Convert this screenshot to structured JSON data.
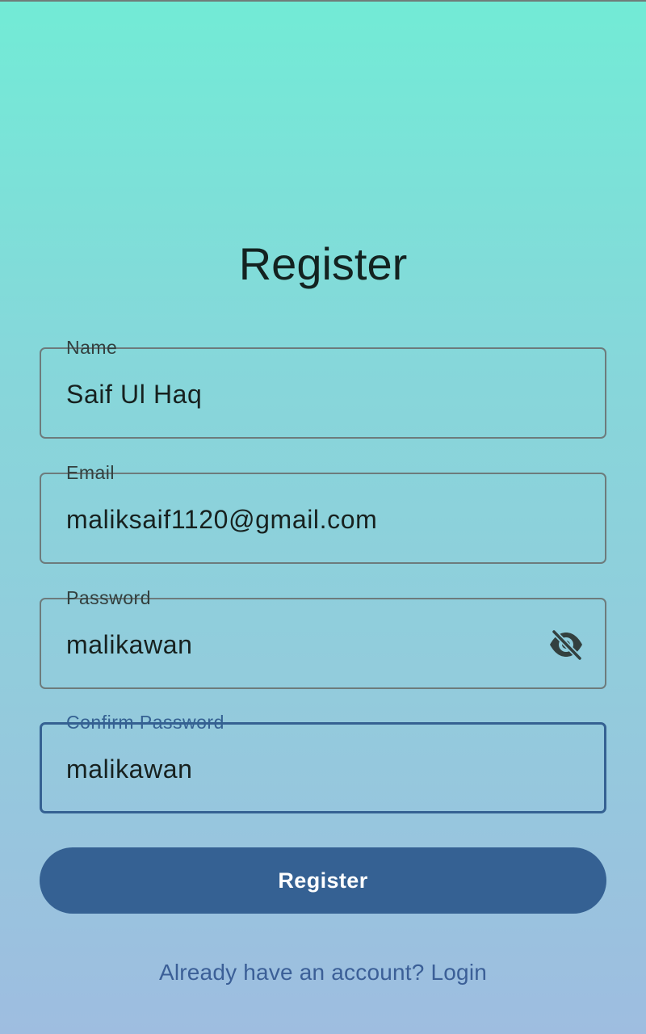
{
  "page": {
    "title": "Register"
  },
  "form": {
    "name": {
      "label": "Name",
      "value": "Saif Ul Haq"
    },
    "email": {
      "label": "Email",
      "value": "maliksaif1120@gmail.com"
    },
    "password": {
      "label": "Password",
      "value": "malikawan",
      "toggle_icon": "eye-off-icon"
    },
    "confirm_password": {
      "label": "Confirm Password",
      "value": "malikawan",
      "focused": true
    }
  },
  "actions": {
    "register_label": "Register",
    "login_link_label": "Already have an account? Login"
  },
  "colors": {
    "accent": "#356193",
    "focus_outline": "#356192",
    "link": "#3b5f97",
    "gradient_top": "#72ebd6",
    "gradient_bottom": "#9ebde0"
  }
}
